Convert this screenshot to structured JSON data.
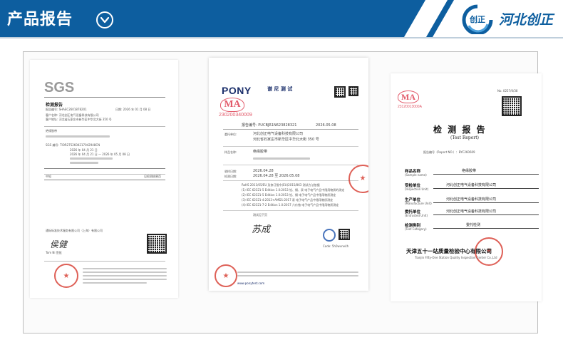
{
  "header": {
    "title": "产品报告",
    "chevron_icon": "chevron-down-circle-icon",
    "brand_name": "河北创正",
    "logo_mark": "创正",
    "colors": {
      "banner": "#0d5e9f",
      "brand_text": "#0d5e9f"
    }
  },
  "documents": [
    {
      "id": "sgs",
      "logo": "SGS",
      "heading": "检测报告",
      "report_no": "报告编号: SHAEC2601878201",
      "page_date": "日期: 2026 年 01 月 08 日",
      "client_line": "客户名称:  河北创正电气设备科技有限公司",
      "address_line": "客户地址:  河北省石家庄市新华区中华北大街 350 号",
      "sample_name": "绝缘胶带",
      "sgs_no": "SGS 编号:   TIOR2752604217042948CN",
      "received": "2026 年 04 月 21 日",
      "test_period": "2026 年 04 月 21 日 — 2026 年 05 月 08 日",
      "result_label": "中铅",
      "result_value": "见检测结果页",
      "company_footer": "通标标准技术服务有限公司（上海）有限公司",
      "signature": "侯健",
      "signer": "Tom Ni 签批"
    },
    {
      "id": "pony",
      "logo": "PONY",
      "logo_cn": "谱 尼 测 试",
      "ma_number": "230200340009",
      "report_no": "报告编号: PUCBJR1N623828321",
      "date": "2026.05.08",
      "client": "河北创正电气设备科技有限公司",
      "address": "河北省石家庄市新华区中华北大街 350 号",
      "sample": "绝缘胶带",
      "received": "2026.04.28",
      "period": "2026.04.28 至 2026.05.08",
      "basis": "RoHS 2011/65/EU 及修订指令(EU)2015/863 测试方法依据",
      "std_1": "(1) IEC 62321-5 Edition 1.0:2013 铅、镉、汞 电子电气产品中限用物质的测定",
      "std_2": "(2) IEC 62321-5 Edition 1.0:2013 铅、镉 电子电气产品中限用物质测定",
      "std_3": "(3) IEC 62321-4:2013+AMD1:2017 汞 电子电气产品中限用物质测定",
      "std_4": "(4) IEC 62321-7-2 Edition 1.0:2017 六价铬 电子电气产品中限用物质测定",
      "conclusion": "测试见下页",
      "signature": "苏成",
      "code_label": "Code: 5h0wvne4h",
      "footer_website": "www.ponytest.com"
    },
    {
      "id": "tianjin",
      "ma_number": "23120013000A",
      "report_no_label": "No. 0257/0/38",
      "title": "检 测 报 告",
      "subtitle": "(Test Report)",
      "report_no": "报告编号（Report NO.）：BYC260609",
      "fields": [
        {
          "label": "样品名称",
          "sub": "(Sample name)",
          "value": "绝缘胶带"
        },
        {
          "label": "受检单位",
          "sub": "(Inspection Unit)",
          "value": "河北创正电气设备科技有限公司"
        },
        {
          "label": "生产单位",
          "sub": "(Manufacture Unit)",
          "value": "河北创正电气设备科技有限公司"
        },
        {
          "label": "委托单位",
          "sub": "(Entrusted Unit)",
          "value": "河北创正电气设备科技有限公司"
        },
        {
          "label": "检测类别",
          "sub": "(Test Category)",
          "value": "委托检测"
        }
      ],
      "institution": "天津五十一站质量检验中心有限公司",
      "institution_en": "Tianjin Fifty-One Station Quality Inspection Center Co.,Ltd"
    }
  ]
}
